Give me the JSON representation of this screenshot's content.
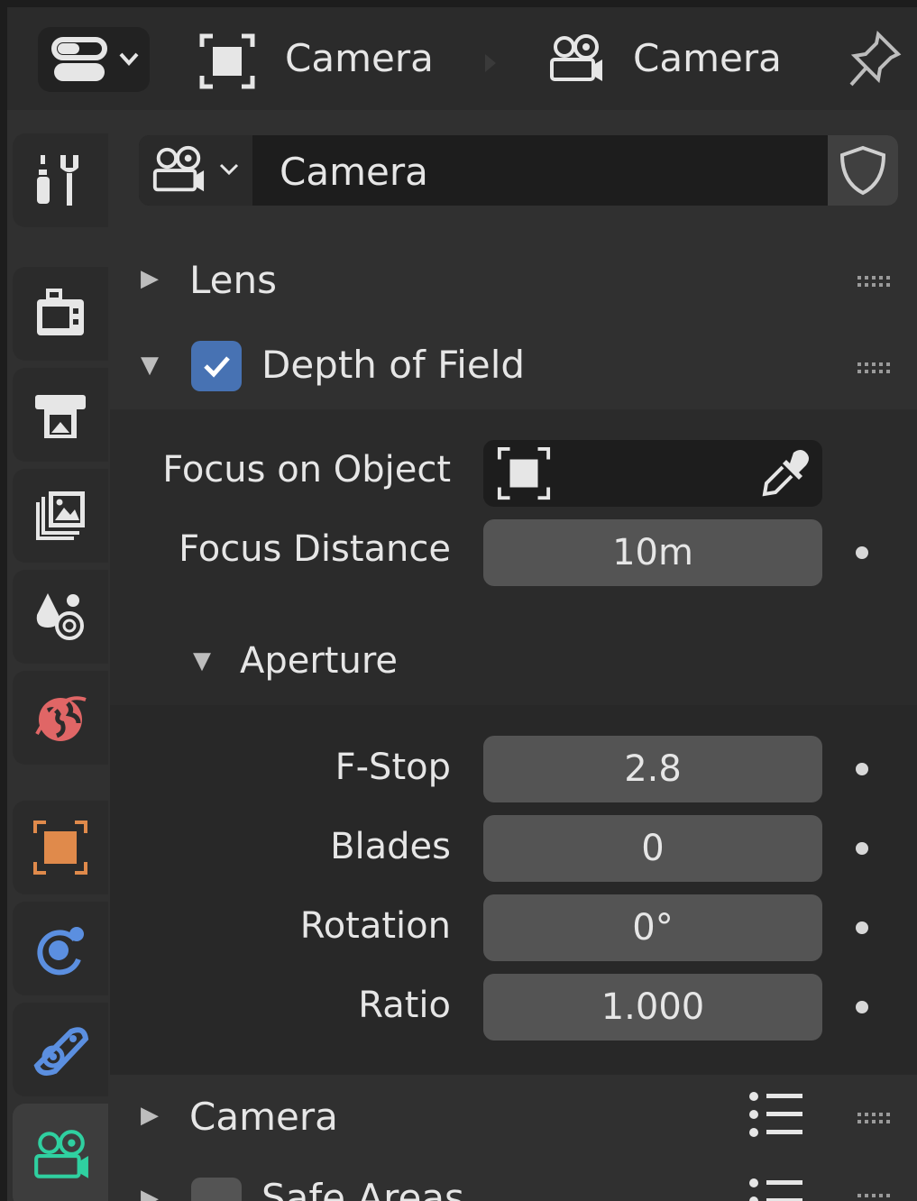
{
  "breadcrumb": {
    "object_name": "Camera",
    "data_name": "Camera"
  },
  "datablock": {
    "name": "Camera"
  },
  "panels": {
    "lens": {
      "title": "Lens"
    },
    "dof": {
      "title": "Depth of Field",
      "enabled": true,
      "focus_object_label": "Focus on Object",
      "focus_distance_label": "Focus Distance",
      "focus_distance_value": "10m",
      "aperture": {
        "title": "Aperture",
        "fstop_label": "F-Stop",
        "fstop_value": "2.8",
        "blades_label": "Blades",
        "blades_value": "0",
        "rotation_label": "Rotation",
        "rotation_value": "0°",
        "ratio_label": "Ratio",
        "ratio_value": "1.000"
      }
    },
    "camera": {
      "title": "Camera"
    },
    "safe_areas": {
      "title": "Safe Areas",
      "enabled": false
    }
  },
  "sidebar": {
    "tabs": [
      {
        "icon": "tool-icon"
      },
      {
        "icon": "render-icon"
      },
      {
        "icon": "output-icon"
      },
      {
        "icon": "view-layer-icon"
      },
      {
        "icon": "scene-icon"
      },
      {
        "icon": "world-icon"
      },
      {
        "icon": "object-icon"
      },
      {
        "icon": "physics-icon"
      },
      {
        "icon": "constraints-icon"
      },
      {
        "icon": "camera-data-icon",
        "active": true
      }
    ]
  },
  "colors": {
    "accent_blue": "#4772b3",
    "object_orange": "#e08a4b",
    "world_red": "#e06666",
    "physics_blue": "#5b8fe0",
    "camera_green": "#2fd0a0"
  }
}
